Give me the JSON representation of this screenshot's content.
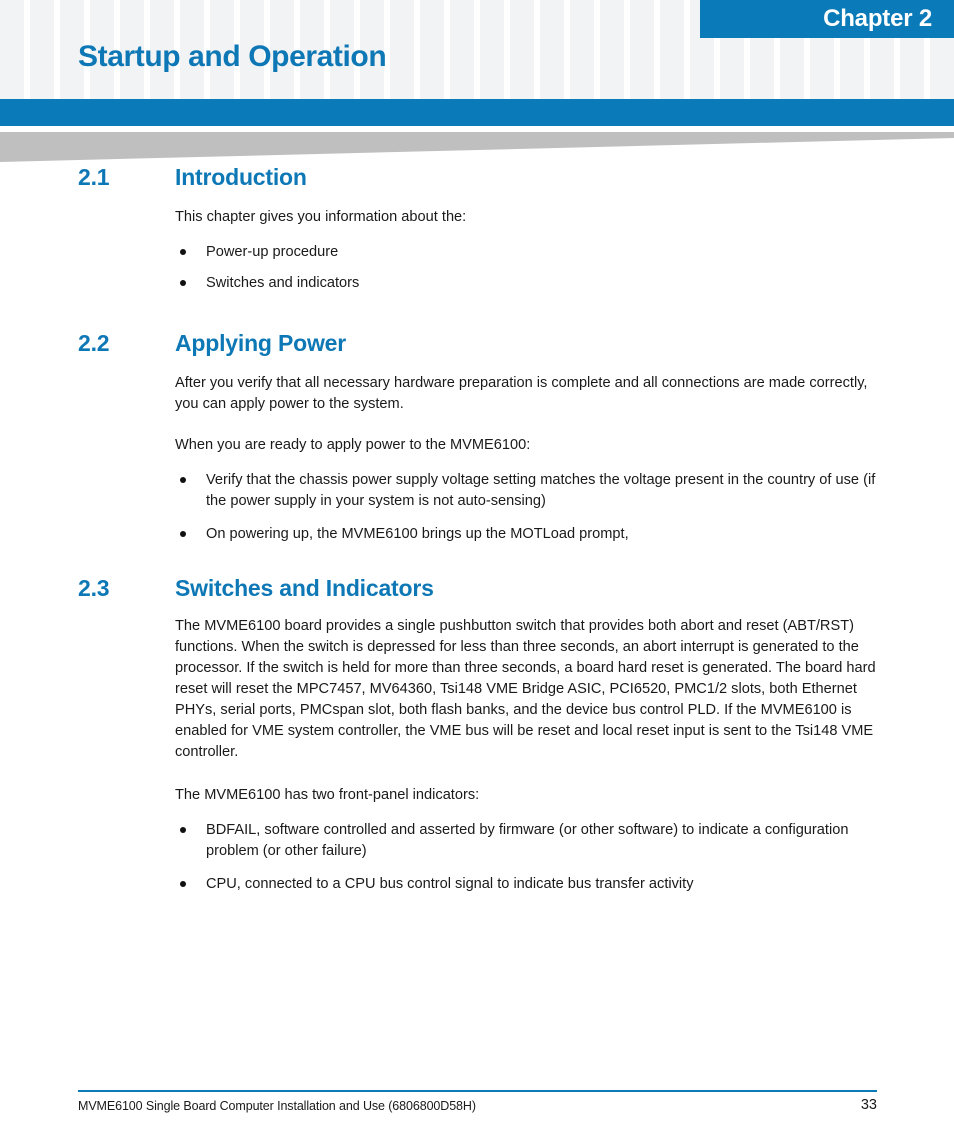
{
  "header": {
    "chapter_badge": "Chapter 2",
    "chapter_title": "Startup and Operation",
    "accent_color": "#0a7ab8",
    "heading_color": "#0d78b5",
    "grid_color": "#f2f3f4",
    "wedge_color": "#bfbfbf"
  },
  "sections": [
    {
      "number": "2.1",
      "title": "Introduction",
      "intro": "This chapter gives you information about the:",
      "bullets": [
        "Power-up procedure",
        "Switches and indicators"
      ]
    },
    {
      "number": "2.2",
      "title": "Applying Power",
      "para1": "After you verify that all necessary hardware preparation is complete and all connections are made correctly, you can apply power to the system.",
      "para2": "When you are ready to apply power to the MVME6100:",
      "bullets": [
        "Verify that the chassis power supply voltage setting matches the voltage present in the country of use (if the power supply in your system is not auto-sensing)",
        "On powering up, the MVME6100 brings up the MOTLoad prompt,"
      ]
    },
    {
      "number": "2.3",
      "title": "Switches and Indicators",
      "para1": "The MVME6100 board provides a single pushbutton switch that provides both abort and reset (ABT/RST) functions. When the switch is depressed for less than three seconds, an abort interrupt is generated to the processor. If the switch is held for more than three seconds, a board hard reset is generated. The board hard reset will reset the MPC7457, MV64360, Tsi148 VME Bridge ASIC, PCI6520, PMC1/2 slots, both Ethernet PHYs, serial ports, PMCspan slot, both flash banks, and the device bus control PLD. If the MVME6100 is enabled for VME system controller, the VME bus will be reset and local reset input is sent to the Tsi148 VME controller.",
      "para2": "The MVME6100 has two front-panel indicators:",
      "bullets": [
        "BDFAIL, software controlled and asserted by firmware (or other software) to indicate a configuration problem (or other failure)",
        "CPU, connected to a CPU bus control signal to indicate bus transfer activity"
      ]
    }
  ],
  "footer": {
    "document_title": "MVME6100 Single Board Computer Installation and Use (6806800D58H)",
    "page_number": "33"
  }
}
